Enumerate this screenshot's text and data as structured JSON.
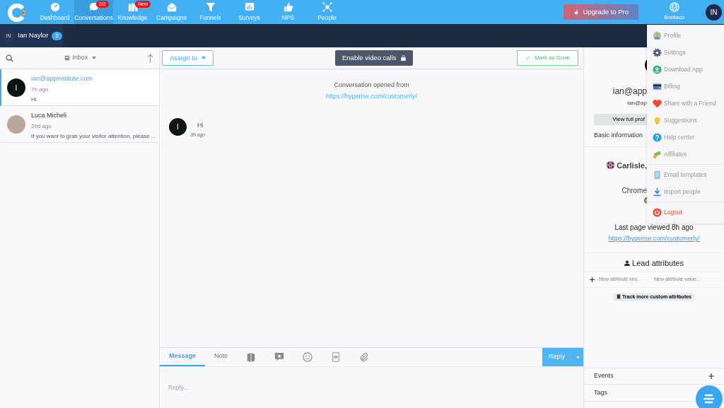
{
  "topnav": {
    "items": [
      {
        "label": "Dashboard",
        "selected": false
      },
      {
        "label": "Conversations",
        "selected": true,
        "badge": "2/2"
      },
      {
        "label": "Knowledge",
        "selected": false,
        "badge": "New"
      },
      {
        "label": "Campaigns",
        "selected": false
      },
      {
        "label": "Funnels",
        "selected": false
      },
      {
        "label": "Surveys",
        "selected": false
      },
      {
        "label": "NPS",
        "selected": false
      },
      {
        "label": "People",
        "selected": false
      }
    ],
    "upgrade_button": "Upgrade to Pro",
    "workspace": "Brellaco",
    "user_initials": "IN"
  },
  "subbar": {
    "initials": "IN",
    "name": "Ian Naylor",
    "count": "2"
  },
  "inbox": {
    "filter": "Inbox",
    "conversations": [
      {
        "title": "ian@appinstitute.com",
        "time": "7h ago",
        "preview": "Hi",
        "initial": "I",
        "kind": "initial",
        "selected": true
      },
      {
        "title": "Luca Micheli",
        "time": "20d ago",
        "preview": "If you want to grab your visitor attention, please ...",
        "kind": "photo",
        "selected": false
      }
    ]
  },
  "conversation": {
    "assign_button": "Assign to",
    "video_button": "Enable video calls",
    "done_button": "Mark as Done",
    "opened_text": "Conversation opened from",
    "opened_link": "https://hyperise.com/customerly/",
    "messages": [
      {
        "initial": "I",
        "text": "Hi",
        "time": "8h ago"
      }
    ]
  },
  "composer": {
    "tabs": [
      {
        "label": "Message",
        "selected": true
      },
      {
        "label": "Note",
        "selected": false
      }
    ],
    "reply_button": "Reply",
    "placeholder": "Reply..."
  },
  "profile": {
    "name": "ian@app",
    "email": "ian@ap",
    "view_button": "View full prof",
    "basic_title": "Basic information",
    "location": "Carlisle,",
    "browser": "Chrome",
    "last_page_title": "Last page viewed 8h ago",
    "last_page_link": "https://hyperise.com/customerly/",
    "lead_title": "Lead attributes",
    "key_placeholder": "New attribute key...",
    "value_placeholder": "New attribute value...",
    "track_button": "Track more custom attributes",
    "sections": [
      "Events",
      "Tags"
    ]
  },
  "user_menu": {
    "groups": [
      [
        {
          "label": "Profile",
          "kind": "normal"
        },
        {
          "label": "Settings",
          "kind": "normal"
        },
        {
          "label": "Download App",
          "kind": "normal"
        },
        {
          "label": "Billing",
          "kind": "normal"
        },
        {
          "label": "Share with a Friend",
          "kind": "normal"
        },
        {
          "label": "Suggestions",
          "kind": "normal"
        },
        {
          "label": "Help center",
          "kind": "normal"
        },
        {
          "label": "Affiliates",
          "kind": "normal"
        }
      ],
      [
        {
          "label": "Email templates",
          "kind": "normal"
        },
        {
          "label": "Import people",
          "kind": "normal"
        }
      ],
      [
        {
          "label": "Logout",
          "kind": "danger"
        }
      ]
    ]
  }
}
